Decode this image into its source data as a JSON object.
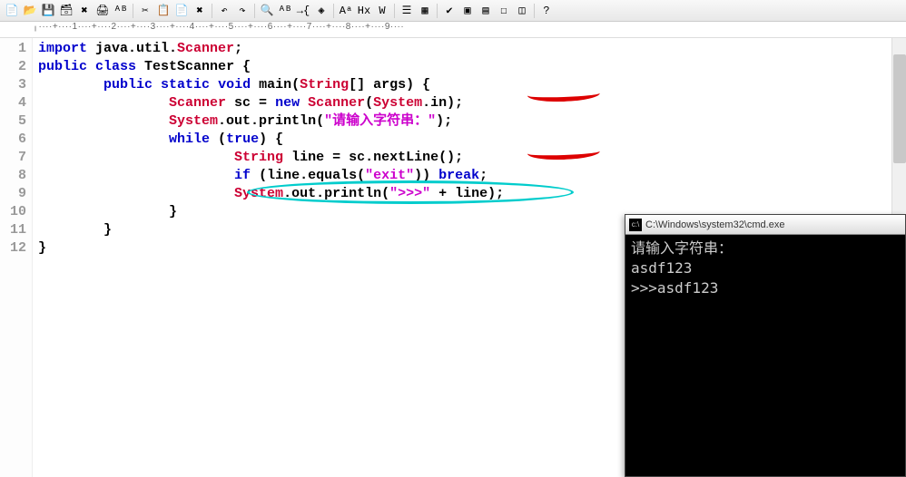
{
  "toolbar_icons": [
    {
      "name": "new-icon",
      "glyph": "📄"
    },
    {
      "name": "open-icon",
      "glyph": "📂"
    },
    {
      "name": "save-icon",
      "glyph": "💾"
    },
    {
      "name": "save-all-icon",
      "glyph": "🗃"
    },
    {
      "name": "close-icon",
      "glyph": "✖"
    },
    {
      "name": "print-icon",
      "glyph": "🖨"
    },
    {
      "name": "spell-icon",
      "glyph": "ᴬᴮ"
    },
    {
      "name": "sep",
      "glyph": ""
    },
    {
      "name": "cut-icon",
      "glyph": "✂"
    },
    {
      "name": "copy-icon",
      "glyph": "📋"
    },
    {
      "name": "paste-icon",
      "glyph": "📄"
    },
    {
      "name": "delete-icon",
      "glyph": "✖"
    },
    {
      "name": "sep",
      "glyph": ""
    },
    {
      "name": "undo-icon",
      "glyph": "↶"
    },
    {
      "name": "redo-icon",
      "glyph": "↷"
    },
    {
      "name": "sep",
      "glyph": ""
    },
    {
      "name": "find-icon",
      "glyph": "🔍"
    },
    {
      "name": "find-replace-icon",
      "glyph": "ᴬᴮ"
    },
    {
      "name": "goto-icon",
      "glyph": "→{"
    },
    {
      "name": "bookmark-icon",
      "glyph": "◈"
    },
    {
      "name": "sep",
      "glyph": ""
    },
    {
      "name": "font-size-icon",
      "glyph": "Aᵃ"
    },
    {
      "name": "hex-icon",
      "glyph": "Hx"
    },
    {
      "name": "wrap-icon",
      "glyph": "W"
    },
    {
      "name": "sep",
      "glyph": ""
    },
    {
      "name": "list-icon",
      "glyph": "☰"
    },
    {
      "name": "column-icon",
      "glyph": "▦"
    },
    {
      "name": "sep",
      "glyph": ""
    },
    {
      "name": "check-icon",
      "glyph": "✔"
    },
    {
      "name": "tool-icon",
      "glyph": "▣"
    },
    {
      "name": "tool2-icon",
      "glyph": "▤"
    },
    {
      "name": "tool3-icon",
      "glyph": "☐"
    },
    {
      "name": "tool4-icon",
      "glyph": "◫"
    },
    {
      "name": "sep",
      "glyph": ""
    },
    {
      "name": "help-icon",
      "glyph": "?"
    }
  ],
  "ruler_text": "╷····+····1····+····2····+····3····+····4····+····5····+····6····+····7····+····8····+····9····",
  "line_numbers": [
    "1",
    "2",
    "3",
    "4",
    "5",
    "6",
    "7",
    "8",
    "9",
    "10",
    "11",
    "12"
  ],
  "code_lines": [
    [
      {
        "c": "kw",
        "t": "import"
      },
      {
        "c": "pln",
        "t": " java.util."
      },
      {
        "c": "typ",
        "t": "Scanner"
      },
      {
        "c": "pln",
        "t": ";"
      }
    ],
    [
      {
        "c": "kw",
        "t": "public"
      },
      {
        "c": "pln",
        "t": " "
      },
      {
        "c": "kw",
        "t": "class"
      },
      {
        "c": "pln",
        "t": " TestScanner {"
      }
    ],
    [
      {
        "c": "pln",
        "t": "        "
      },
      {
        "c": "kw",
        "t": "public"
      },
      {
        "c": "pln",
        "t": " "
      },
      {
        "c": "kw",
        "t": "static"
      },
      {
        "c": "pln",
        "t": " "
      },
      {
        "c": "kw",
        "t": "void"
      },
      {
        "c": "pln",
        "t": " main("
      },
      {
        "c": "typ",
        "t": "String"
      },
      {
        "c": "pln",
        "t": "[] args) {"
      }
    ],
    [
      {
        "c": "pln",
        "t": "                "
      },
      {
        "c": "typ",
        "t": "Scanner"
      },
      {
        "c": "pln",
        "t": " sc = "
      },
      {
        "c": "kw",
        "t": "new"
      },
      {
        "c": "pln",
        "t": " "
      },
      {
        "c": "typ",
        "t": "Scanner"
      },
      {
        "c": "pln",
        "t": "("
      },
      {
        "c": "typ",
        "t": "System"
      },
      {
        "c": "pln",
        "t": ".in);"
      }
    ],
    [
      {
        "c": "pln",
        "t": "                "
      },
      {
        "c": "typ",
        "t": "System"
      },
      {
        "c": "pln",
        "t": ".out.println("
      },
      {
        "c": "str",
        "t": "\"请输入字符串：\""
      },
      {
        "c": "pln",
        "t": ");"
      }
    ],
    [
      {
        "c": "pln",
        "t": "                "
      },
      {
        "c": "kw",
        "t": "while"
      },
      {
        "c": "pln",
        "t": " ("
      },
      {
        "c": "kw",
        "t": "true"
      },
      {
        "c": "pln",
        "t": ") {"
      }
    ],
    [
      {
        "c": "pln",
        "t": "                        "
      },
      {
        "c": "typ",
        "t": "String"
      },
      {
        "c": "pln",
        "t": " line = sc.nextLine();"
      }
    ],
    [
      {
        "c": "pln",
        "t": "                        "
      },
      {
        "c": "kw",
        "t": "if"
      },
      {
        "c": "pln",
        "t": " (line.equals("
      },
      {
        "c": "str",
        "t": "\"exit\""
      },
      {
        "c": "pln",
        "t": ")) "
      },
      {
        "c": "kw",
        "t": "break"
      },
      {
        "c": "pln",
        "t": ";"
      }
    ],
    [
      {
        "c": "pln",
        "t": "                        "
      },
      {
        "c": "typ",
        "t": "System"
      },
      {
        "c": "pln",
        "t": ".out.println("
      },
      {
        "c": "str",
        "t": "\">>>\""
      },
      {
        "c": "pln",
        "t": " + line);"
      }
    ],
    [
      {
        "c": "pln",
        "t": "                }"
      }
    ],
    [
      {
        "c": "pln",
        "t": "        }"
      }
    ],
    [
      {
        "c": "pln",
        "t": "}"
      }
    ]
  ],
  "cmd": {
    "title": "C:\\Windows\\system32\\cmd.exe",
    "icon_text": "c:\\",
    "lines": [
      "请输入字符串：",
      "asdf123",
      ">>>asdf123"
    ]
  }
}
